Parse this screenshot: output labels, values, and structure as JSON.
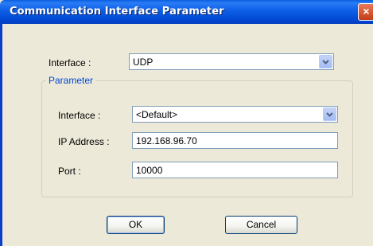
{
  "window": {
    "title": "Communication Interface Parameter",
    "close_glyph": "×"
  },
  "interface_field": {
    "label": "Interface :",
    "value": "UDP"
  },
  "parameter_group": {
    "legend": "Parameter",
    "interface": {
      "label": "Interface :",
      "value": "<Default>"
    },
    "ip_address": {
      "label": "IP Address :",
      "value": "192.168.96.70"
    },
    "port": {
      "label": "Port :",
      "value": "10000"
    }
  },
  "buttons": {
    "ok": "OK",
    "cancel": "Cancel"
  },
  "icons": {
    "dropdown": "chevron-down-icon",
    "close": "close-icon"
  },
  "colors": {
    "title_bar": "#0349d3",
    "close_button": "#d5532f",
    "group_legend": "#0046d5",
    "window_bg": "#ece9d8"
  }
}
